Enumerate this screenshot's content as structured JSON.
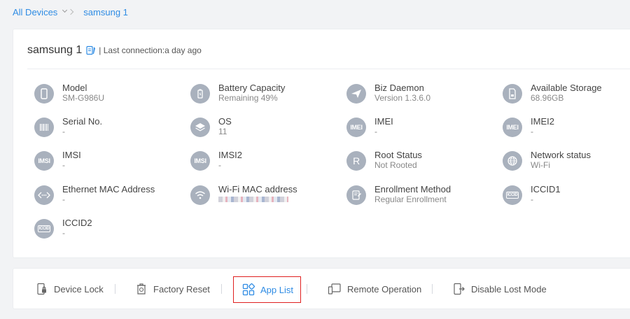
{
  "breadcrumb": {
    "root": "All Devices",
    "current": "samsung 1"
  },
  "header": {
    "device_name": "samsung 1",
    "last_connection": "| Last connection:a day ago"
  },
  "info": [
    {
      "label": "Model",
      "value": "SM-G986U",
      "icon": "phone-icon"
    },
    {
      "label": "Battery Capacity",
      "value": "Remaining 49%",
      "icon": "battery-icon"
    },
    {
      "label": "Biz Daemon",
      "value": "Version 1.3.6.0",
      "icon": "paper-plane-icon"
    },
    {
      "label": "Available Storage",
      "value": "68.96GB",
      "icon": "sd-card-icon"
    },
    {
      "label": "Serial No.",
      "value": "-",
      "icon": "barcode-icon"
    },
    {
      "label": "OS",
      "value": "11",
      "icon": "layers-icon"
    },
    {
      "label": "IMEI",
      "value": "-",
      "icon": "imei-icon",
      "glyph": "IMEI"
    },
    {
      "label": "IMEI2",
      "value": "-",
      "icon": "imei2-icon",
      "glyph": "IMEI"
    },
    {
      "label": "IMSI",
      "value": "-",
      "icon": "imsi-icon",
      "glyph": "IMSI"
    },
    {
      "label": "IMSI2",
      "value": "-",
      "icon": "imsi2-icon",
      "glyph": "IMSI"
    },
    {
      "label": "Root Status",
      "value": "Not Rooted",
      "icon": "root-icon",
      "glyph": "R"
    },
    {
      "label": "Network status",
      "value": "Wi-Fi",
      "icon": "globe-icon"
    },
    {
      "label": "Ethernet MAC Address",
      "value": "-",
      "icon": "ethernet-icon"
    },
    {
      "label": "Wi-Fi MAC address",
      "value": "",
      "icon": "wifi-icon"
    },
    {
      "label": "Enrollment Method",
      "value": "Regular Enrollment",
      "icon": "enrollment-icon"
    },
    {
      "label": "ICCID1",
      "value": "-",
      "icon": "iccid1-icon",
      "glyph": "ICCID"
    },
    {
      "label": "ICCID2",
      "value": "-",
      "icon": "iccid2-icon",
      "glyph": "ICCID"
    }
  ],
  "actions": {
    "device_lock": "Device Lock",
    "factory_reset": "Factory Reset",
    "app_list": "App List",
    "remote_operation": "Remote Operation",
    "disable_lost_mode": "Disable Lost Mode"
  },
  "colors": {
    "accent": "#2f8ce4",
    "icon_bg": "#a9b1bd",
    "highlight": "#e02020"
  }
}
